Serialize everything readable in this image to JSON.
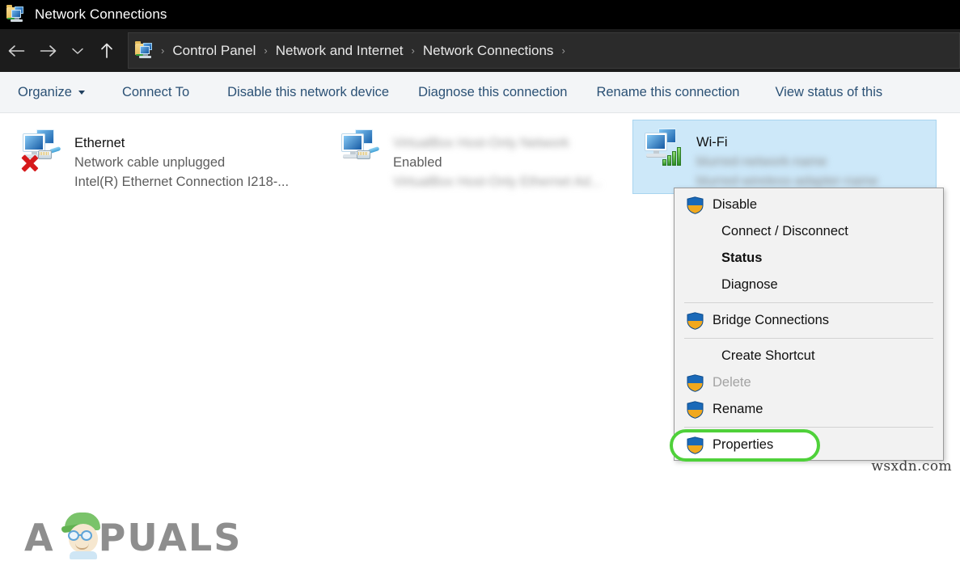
{
  "window": {
    "title": "Network Connections",
    "icon": "network-folder-icon"
  },
  "addressbar": {
    "back_icon": "back-arrow-icon",
    "forward_icon": "forward-arrow-icon",
    "recent_icon": "chevron-down-icon",
    "up_icon": "up-arrow-icon",
    "path_icon": "network-folder-icon",
    "breadcrumbs": [
      {
        "label": "Control Panel"
      },
      {
        "label": "Network and Internet"
      },
      {
        "label": "Network Connections"
      }
    ],
    "separator": "›"
  },
  "toolbar": {
    "items": [
      {
        "label": "Organize",
        "has_caret": true
      },
      {
        "label": "Connect To",
        "has_caret": false
      },
      {
        "label": "Disable this network device",
        "has_caret": false
      },
      {
        "label": "Diagnose this connection",
        "has_caret": false
      },
      {
        "label": "Rename this connection",
        "has_caret": false
      },
      {
        "label": "View status of this",
        "has_caret": false
      }
    ]
  },
  "connections": [
    {
      "name": "Ethernet",
      "status": "Network cable unplugged",
      "device": "Intel(R) Ethernet Connection I218-...",
      "selected": false,
      "blurred": false,
      "disconnected": true,
      "wireless": false,
      "icon": "network-adapter-icon"
    },
    {
      "name": "VirtualBox Host-Only Network",
      "status": "Enabled",
      "device": "VirtualBox Host-Only Ethernet Ad...",
      "selected": false,
      "blurred": true,
      "disconnected": false,
      "wireless": false,
      "icon": "network-adapter-icon"
    },
    {
      "name": "Wi-Fi",
      "status": "blurred-network-name",
      "device": "blurred-wireless-adapter-name",
      "selected": true,
      "blurred": true,
      "disconnected": false,
      "wireless": true,
      "icon": "wireless-adapter-icon"
    }
  ],
  "context_menu": {
    "items": [
      {
        "label": "Disable",
        "shield": true,
        "bold": false,
        "disabled": false,
        "highlighted": false
      },
      {
        "label": "Connect / Disconnect",
        "shield": false,
        "bold": false,
        "disabled": false,
        "highlighted": false
      },
      {
        "label": "Status",
        "shield": false,
        "bold": true,
        "disabled": false,
        "highlighted": false
      },
      {
        "label": "Diagnose",
        "shield": false,
        "bold": false,
        "disabled": false,
        "highlighted": false
      },
      {
        "separator": true
      },
      {
        "label": "Bridge Connections",
        "shield": true,
        "bold": false,
        "disabled": false,
        "highlighted": false
      },
      {
        "separator": true
      },
      {
        "label": "Create Shortcut",
        "shield": false,
        "bold": false,
        "disabled": false,
        "highlighted": false
      },
      {
        "label": "Delete",
        "shield": true,
        "bold": false,
        "disabled": true,
        "highlighted": false
      },
      {
        "label": "Rename",
        "shield": true,
        "bold": false,
        "disabled": false,
        "highlighted": false
      },
      {
        "separator": true
      },
      {
        "label": "Properties",
        "shield": true,
        "bold": false,
        "disabled": false,
        "highlighted": true
      }
    ],
    "shield_icon": "uac-shield-icon",
    "highlight_color": "#4fd13a"
  },
  "watermarks": {
    "logo_text": "PUALS",
    "logo_initial": "A",
    "site": "wsxdn.com"
  },
  "colors": {
    "titlebar_bg": "#000000",
    "addressbar_bg": "#1c1c1c",
    "toolbar_bg": "#f3f5f7",
    "toolbar_text": "#2b5175",
    "selection_bg": "#cde8f9",
    "menu_bg": "#f2f2f2",
    "highlight_green": "#4fd13a"
  }
}
